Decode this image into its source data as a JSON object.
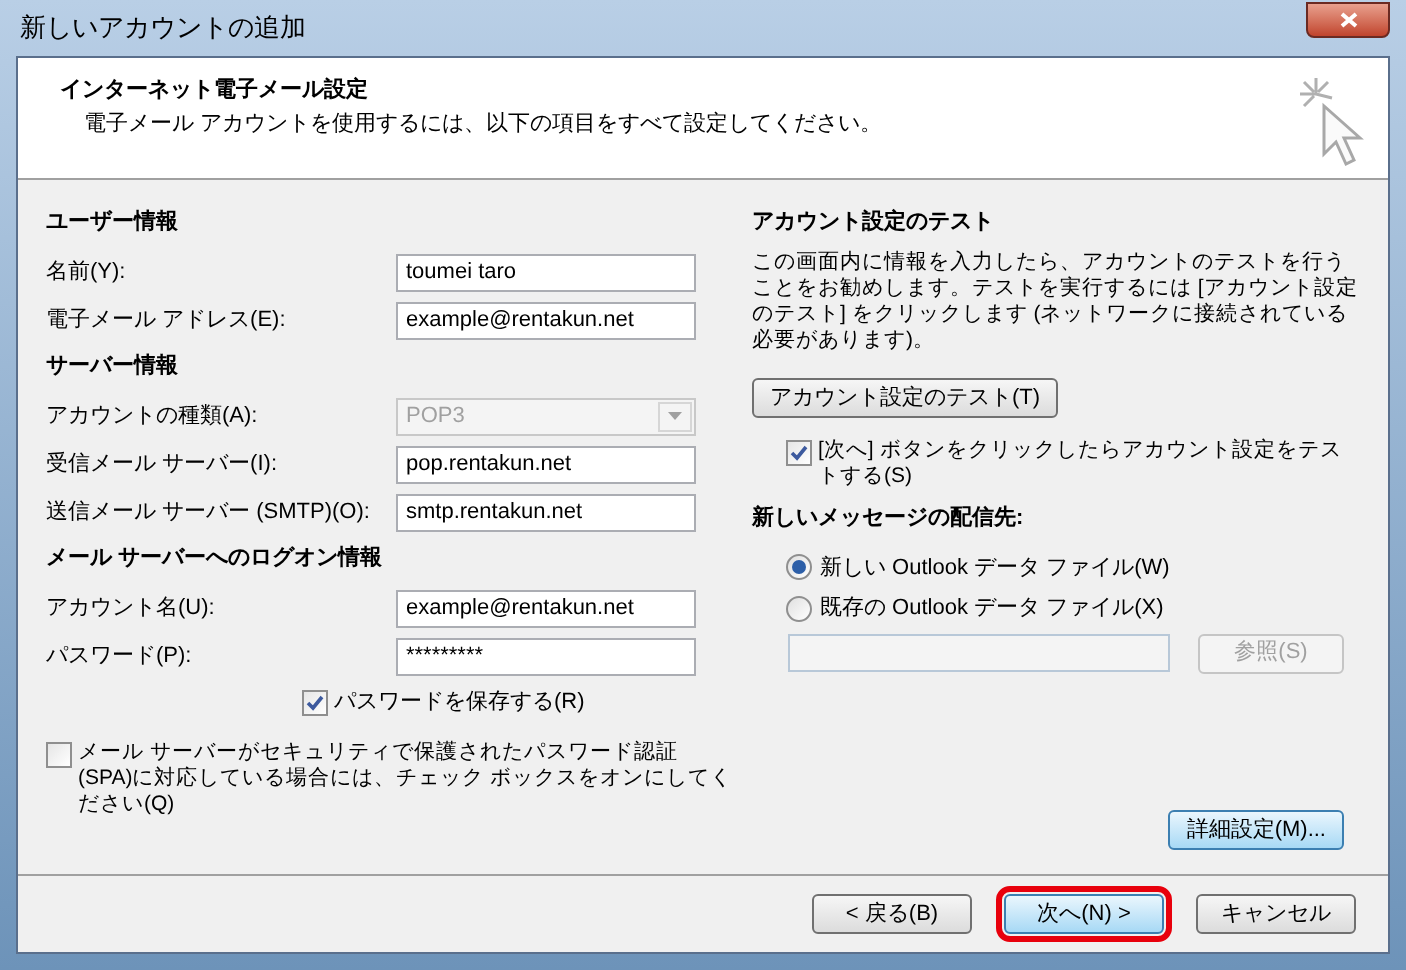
{
  "window": {
    "title": "新しいアカウントの追加"
  },
  "header": {
    "title": "インターネット電子メール設定",
    "subtitle": "電子メール アカウントを使用するには、以下の項目をすべて設定してください。"
  },
  "left": {
    "sections": [
      {
        "heading": "ユーザー情報",
        "fields": [
          {
            "label": "名前(Y):",
            "kind": "text",
            "value": "toumei taro",
            "disabled": false
          },
          {
            "label": "電子メール アドレス(E):",
            "kind": "text",
            "value": "example@rentakun.net",
            "disabled": false
          }
        ]
      },
      {
        "heading": "サーバー情報",
        "fields": [
          {
            "label": "アカウントの種類(A):",
            "kind": "dropdown",
            "value": "POP3",
            "disabled": true
          },
          {
            "label": "受信メール サーバー(I):",
            "kind": "text",
            "value": "pop.rentakun.net",
            "disabled": false
          },
          {
            "label": "送信メール サーバー (SMTP)(O):",
            "kind": "text",
            "value": "smtp.rentakun.net",
            "disabled": false
          }
        ]
      },
      {
        "heading": "メール サーバーへのログオン情報",
        "fields": [
          {
            "label": "アカウント名(U):",
            "kind": "text",
            "value": "example@rentakun.net",
            "disabled": false
          },
          {
            "label": "パスワード(P):",
            "kind": "text",
            "value": "*********",
            "disabled": false
          }
        ]
      }
    ],
    "save_password": {
      "label": "パスワードを保存する(R)",
      "checked": true
    },
    "spa": {
      "label": "メール サーバーがセキュリティで保護されたパスワード認証 (SPA)に対応している場合には、チェック ボックスをオンにしてください(Q)",
      "checked": false
    }
  },
  "right": {
    "heading": "アカウント設定のテスト",
    "description": "この画面内に情報を入力したら、アカウントのテストを行うことをお勧めします。テストを実行するには [アカウント設定のテスト] をクリックします (ネットワークに接続されている必要があります)。",
    "test_button": "アカウント設定のテスト(T)",
    "auto_test": {
      "label": "[次へ] ボタンをクリックしたらアカウント設定をテストする(S)",
      "checked": true
    },
    "delivery_heading": "新しいメッセージの配信先:",
    "delivery_options": [
      {
        "label": "新しい Outlook データ ファイル(W)",
        "selected": true
      },
      {
        "label": "既存の Outlook データ ファイル(X)",
        "selected": false
      }
    ],
    "browse": {
      "label": "参照(S)",
      "disabled": true
    },
    "advanced_button": "詳細設定(M)..."
  },
  "footer": [
    {
      "label": "< 戻る(B)",
      "highlighted": false
    },
    {
      "label": "次へ(N) >",
      "highlighted": true
    },
    {
      "label": "キャンセル",
      "highlighted": false
    }
  ]
}
